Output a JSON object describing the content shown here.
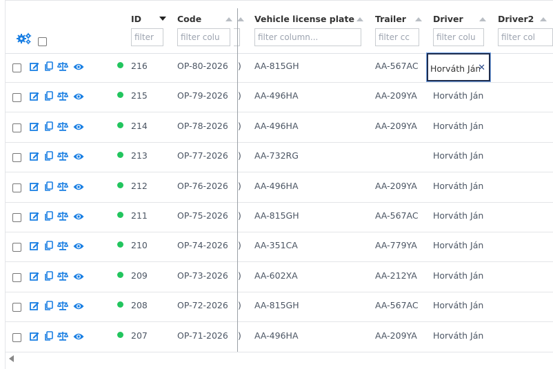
{
  "header": {
    "columns": [
      {
        "key": "id",
        "label": "ID",
        "placeholder": "filter",
        "sort": "desc"
      },
      {
        "key": "code",
        "label": "Code",
        "placeholder": "filter colu",
        "sort": "none"
      },
      {
        "key": "plate",
        "label": "Vehicle license plate",
        "placeholder": "filter column...",
        "sort": "none"
      },
      {
        "key": "trailer",
        "label": "Trailer",
        "placeholder": "filter cc",
        "sort": "none"
      },
      {
        "key": "driver",
        "label": "Driver",
        "placeholder": "filter colu",
        "sort": "none"
      },
      {
        "key": "driver2",
        "label": "Driver2",
        "placeholder": "filter col",
        "sort": "none"
      }
    ],
    "settings_icon": "gears-icon",
    "select_all_checked": false
  },
  "row_actions": [
    "edit-icon",
    "copy-icon",
    "scale-icon",
    "eye-icon"
  ],
  "colors": {
    "action_blue": "#1a7fe3",
    "status_green": "#22c55e",
    "editor_border": "#1f2d4d"
  },
  "rows": [
    {
      "id": "216",
      "code": "OP-80-2026",
      "clip": ")",
      "plate": "AA-815GH",
      "trailer": "AA-567AC",
      "driver": "Horváth Ján",
      "editing": true
    },
    {
      "id": "215",
      "code": "OP-79-2026",
      "clip": ")",
      "plate": "AA-496HA",
      "trailer": "AA-209YA",
      "driver": "Horváth Ján"
    },
    {
      "id": "214",
      "code": "OP-78-2026",
      "clip": ")",
      "plate": "AA-496HA",
      "trailer": "AA-209YA",
      "driver": "Horváth Ján"
    },
    {
      "id": "213",
      "code": "OP-77-2026",
      "clip": ")",
      "plate": "AA-732RG",
      "trailer": "",
      "driver": "Horváth Ján"
    },
    {
      "id": "212",
      "code": "OP-76-2026",
      "clip": ")",
      "plate": "AA-496HA",
      "trailer": "AA-209YA",
      "driver": "Horváth Ján"
    },
    {
      "id": "211",
      "code": "OP-75-2026",
      "clip": ")",
      "plate": "AA-815GH",
      "trailer": "AA-567AC",
      "driver": "Horváth Ján"
    },
    {
      "id": "210",
      "code": "OP-74-2026",
      "clip": ")",
      "plate": "AA-351CA",
      "trailer": "AA-779YA",
      "driver": "Horváth Ján"
    },
    {
      "id": "209",
      "code": "OP-73-2026",
      "clip": ")",
      "plate": "AA-602XA",
      "trailer": "AA-212YA",
      "driver": "Horváth Ján"
    },
    {
      "id": "208",
      "code": "OP-72-2026",
      "clip": ")",
      "plate": "AA-815GH",
      "trailer": "AA-567AC",
      "driver": "Horváth Ján"
    },
    {
      "id": "207",
      "code": "OP-71-2026",
      "clip": ")",
      "plate": "AA-496HA",
      "trailer": "AA-209YA",
      "driver": "Horváth Ján"
    }
  ]
}
